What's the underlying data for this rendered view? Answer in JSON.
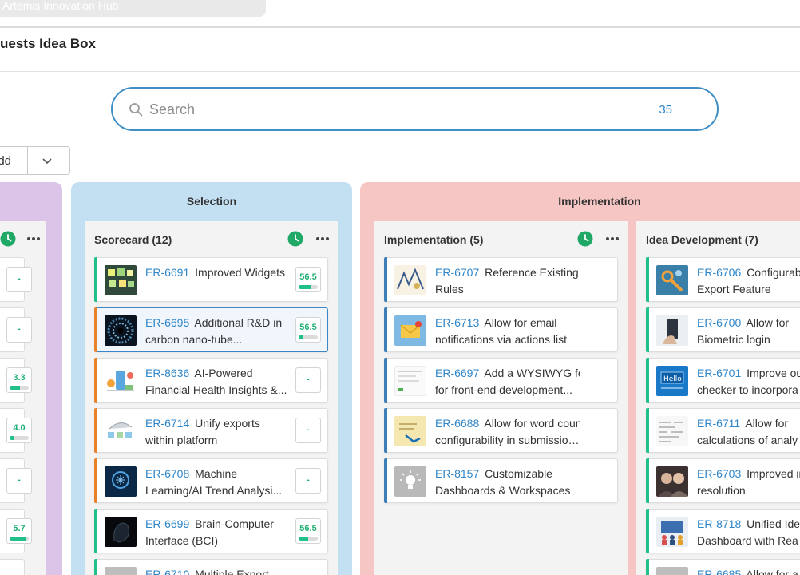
{
  "header": {
    "org_title": "n Artemis Innovation Hub",
    "page_title": "uests Idea Box"
  },
  "search": {
    "placeholder": "Search",
    "count": "35"
  },
  "add_button": {
    "label": "dd"
  },
  "colors": {
    "accent": "#2f86c9",
    "green": "#20c08a",
    "orange": "#e8822a",
    "blue_bar": "#3f7fb8"
  },
  "lanes": [
    {
      "title": "Selection"
    },
    {
      "title": "Implementation"
    }
  ],
  "columns": {
    "left_partial": {
      "scores": [
        "-",
        "-",
        "3.3",
        "4.0",
        "-",
        "5.7"
      ],
      "fills": [
        0,
        0,
        0.55,
        0.25,
        0,
        0.85
      ]
    },
    "scorecard": {
      "title": "Scorecard (12)",
      "cards": [
        {
          "id": "ER-6691",
          "line1": "Improved Widgets",
          "line2": "",
          "score": "56.5",
          "fill": 0.62,
          "icon": "whiteboard-thumb"
        },
        {
          "id": "ER-6695",
          "line1": "Additional R&D in",
          "line2": "carbon nano-tube...",
          "score": "56.5",
          "fill": 0.2,
          "icon": "nanotube-thumb"
        },
        {
          "id": "ER-8636",
          "line1": "AI-Powered",
          "line2": "Financial Health Insights &...",
          "score": "-",
          "fill": 0,
          "icon": "finance-thumb"
        },
        {
          "id": "ER-6714",
          "line1": "Unify exports",
          "line2": "within platform",
          "score": "-",
          "fill": 0,
          "icon": "export-thumb"
        },
        {
          "id": "ER-6708",
          "line1": "Machine",
          "line2": "Learning/AI Trend Analysi...",
          "score": "-",
          "fill": 0,
          "icon": "ai-thumb"
        },
        {
          "id": "ER-6699",
          "line1": "Brain-Computer",
          "line2": "Interface (BCI)",
          "score": "56.5",
          "fill": 0.5,
          "icon": "bci-thumb"
        },
        {
          "id": "ER-6710",
          "line1": "Multiple Export",
          "line2": "",
          "score": "",
          "fill": 0,
          "icon": "gray-thumb"
        }
      ]
    },
    "implementation": {
      "title": "Implementation (5)",
      "cards": [
        {
          "id": "ER-6707",
          "line1": "Reference Existing",
          "line2": "Rules",
          "icon": "sketch-thumb"
        },
        {
          "id": "ER-6713",
          "line1": "Allow for email",
          "line2": "notifications via actions list",
          "icon": "mail-thumb"
        },
        {
          "id": "ER-6697",
          "line1": "Add a WYSIWYG feature",
          "line2": "for front-end development...",
          "icon": "editor-thumb"
        },
        {
          "id": "ER-6688",
          "line1": "Allow for word count",
          "line2": "configurability in submission...",
          "icon": "notes-thumb"
        },
        {
          "id": "ER-8157",
          "line1": "Customizable",
          "line2": "Dashboards & Workspaces",
          "icon": "bulb-thumb"
        }
      ]
    },
    "idea_development": {
      "title": "Idea Development (7)",
      "cards": [
        {
          "id": "ER-6706",
          "line1": "Configurab",
          "line2": "Export Feature",
          "icon": "tools-thumb"
        },
        {
          "id": "ER-6700",
          "line1": "Allow for",
          "line2": "Biometric login",
          "icon": "phone-thumb"
        },
        {
          "id": "ER-6701",
          "line1": "Improve ou",
          "line2": "checker to incorpora",
          "icon": "hello-thumb"
        },
        {
          "id": "ER-6711",
          "line1": "Allow for",
          "line2": "calculations of analy",
          "icon": "math-thumb"
        },
        {
          "id": "ER-6703",
          "line1": "Improved in",
          "line2": "resolution",
          "icon": "people-thumb"
        },
        {
          "id": "ER-8718",
          "line1": "Unified Idea",
          "line2": "Dashboard with Rea",
          "icon": "team-thumb"
        },
        {
          "id": "ER-6685",
          "line1": "Allow for a",
          "line2": "",
          "icon": "gray-thumb"
        }
      ]
    }
  }
}
